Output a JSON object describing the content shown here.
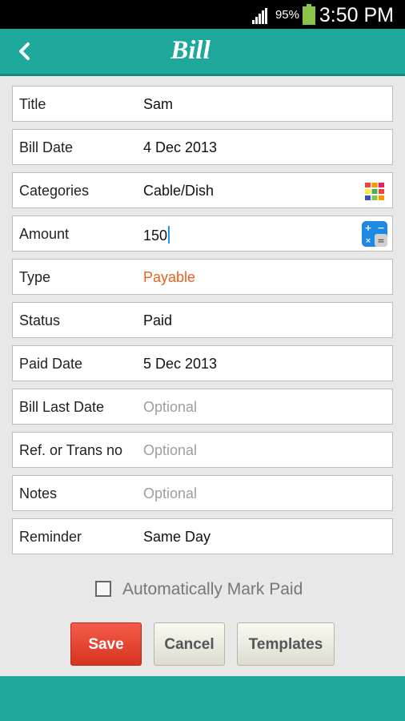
{
  "status_bar": {
    "battery": "95%",
    "time": "3:50 PM"
  },
  "header": {
    "title": "Bill"
  },
  "form": {
    "title": {
      "label": "Title",
      "value": "Sam"
    },
    "bill_date": {
      "label": "Bill Date",
      "value": "4  Dec  2013"
    },
    "categories": {
      "label": "Categories",
      "value": "Cable/Dish"
    },
    "amount": {
      "label": "Amount",
      "value": "150"
    },
    "type": {
      "label": "Type",
      "value": "Payable"
    },
    "status": {
      "label": "Status",
      "value": "Paid"
    },
    "paid_date": {
      "label": "Paid Date",
      "value": "5  Dec  2013"
    },
    "bill_last_date": {
      "label": "Bill Last Date",
      "placeholder": "Optional"
    },
    "ref_trans": {
      "label": "Ref. or Trans no",
      "placeholder": "Optional"
    },
    "notes": {
      "label": "Notes",
      "placeholder": "Optional"
    },
    "reminder": {
      "label": "Reminder",
      "value": "Same Day"
    }
  },
  "auto_mark_paid": {
    "label": "Automatically Mark Paid",
    "checked": false
  },
  "buttons": {
    "save": "Save",
    "cancel": "Cancel",
    "templates": "Templates"
  },
  "colors": {
    "teal": "#1ea89b",
    "accent_orange": "#e8601c",
    "save_red": "#e04030"
  },
  "icons": {
    "back": "chevron-left-icon",
    "categories": "color-grid-icon",
    "amount": "calculator-icon"
  }
}
